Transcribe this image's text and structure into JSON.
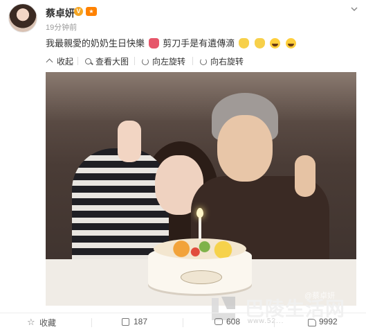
{
  "post": {
    "username": "蔡卓妍",
    "timestamp": "19分钟前",
    "text_before": "我最親愛的奶奶生日快樂",
    "text_after": " 剪刀手是有遺傳滴",
    "emoji_names": [
      "cake-emoji",
      "peace-emoji",
      "peace-emoji",
      "laugh-emoji",
      "laugh-emoji"
    ]
  },
  "toolbar": {
    "collapse": "收起",
    "view_large": "查看大图",
    "rotate_left": "向左旋转",
    "rotate_right": "向右旋转"
  },
  "watermark": {
    "handle": "@蔡卓妍",
    "title": "巴陵生活网",
    "url": "www.52..."
  },
  "actions": {
    "favorite": "收藏",
    "share_count": "187",
    "comment_count": "608",
    "like_count": "9992"
  },
  "colors": {
    "vip_orange": "#ff8200",
    "verified_gold": "#f5a623",
    "text_main": "#333333",
    "text_muted": "#999999"
  }
}
